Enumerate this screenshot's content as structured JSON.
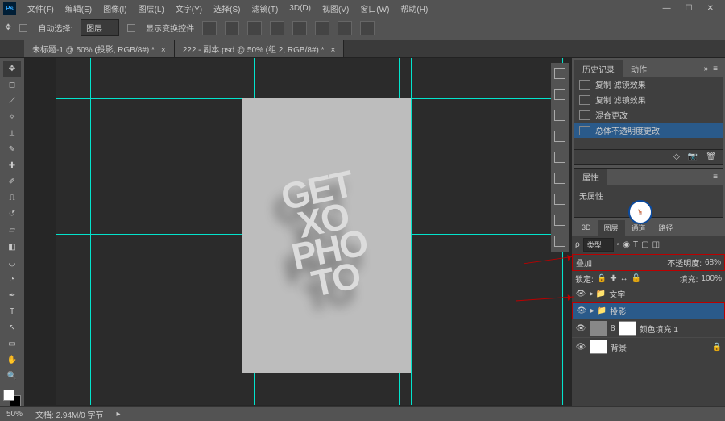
{
  "menu": [
    "文件(F)",
    "编辑(E)",
    "图像(I)",
    "图层(L)",
    "文字(Y)",
    "选择(S)",
    "滤镜(T)",
    "3D(D)",
    "视图(V)",
    "窗口(W)",
    "帮助(H)"
  ],
  "options": {
    "autoSelect": "自动选择:",
    "layerDrop": "图层",
    "showTransform": "显示变换控件"
  },
  "tabs": [
    {
      "label": "未标题-1 @ 50% (投影, RGB/8#) *"
    },
    {
      "label": "222 - 副本.psd @ 50% (组 2, RGB/8#) *"
    }
  ],
  "historyPanel": {
    "tabs": [
      "历史记录",
      "动作"
    ],
    "items": [
      "复制 滤镜效果",
      "复制 滤镜效果",
      "混合更改",
      "总体不透明度更改"
    ]
  },
  "propsPanel": {
    "tab": "属性",
    "empty": "无属性"
  },
  "layersPanel": {
    "tabs": [
      "3D",
      "图层",
      "通道",
      "路径"
    ],
    "kind": "类型",
    "blend": "叠加",
    "opacityLabel": "不透明度:",
    "opacity": "68%",
    "lockLabel": "锁定:",
    "fillLabel": "填充:",
    "fill": "100%",
    "rows": [
      {
        "name": "文字",
        "folder": true
      },
      {
        "name": "投影",
        "folder": true,
        "sel": true,
        "red": true
      },
      {
        "name": "颜色填充 1",
        "link": "8"
      },
      {
        "name": "背景",
        "bg": true
      }
    ]
  },
  "artText": "GET\nXO\nPHO\nTO",
  "status": {
    "zoom": "50%",
    "doc": "文档: 2.94M/0 字节"
  }
}
